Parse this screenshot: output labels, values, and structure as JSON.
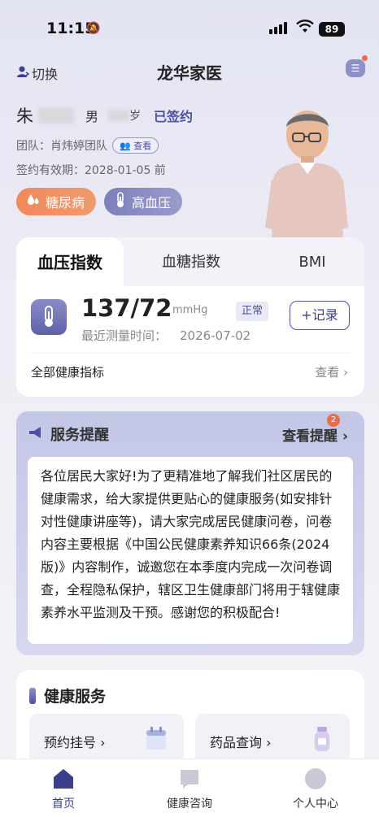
{
  "status": {
    "time": "11:15",
    "battery": "89"
  },
  "nav": {
    "switch_label": "切换",
    "title": "龙华家医"
  },
  "profile": {
    "surname": "朱",
    "gender": "男",
    "age_suffix": "岁",
    "sign_status": "已签约",
    "team_label": "团队：肖炜婷团队",
    "view_label": "查看",
    "validity": "签约有效期：2028-01-05 前",
    "tags": [
      {
        "label": "糖尿病",
        "color": "#f1895c"
      },
      {
        "label": "高血压",
        "color": "#7d7fba"
      }
    ]
  },
  "metrics": {
    "tabs": [
      "血压指数",
      "血糖指数",
      "BMI"
    ],
    "value": "137/72",
    "unit": "mmHg",
    "status": "正常",
    "record_button": "+记录",
    "measure_label": "最近测量时间：",
    "measure_date": "2026-07-02",
    "all_label": "全部健康指标",
    "view_label": "查看"
  },
  "service": {
    "title": "服务提醒",
    "view_label": "查看提醒",
    "badge": "2",
    "notice": "各位居民大家好!为了更精准地了解我们社区居民的健康需求，给大家提供更贴心的健康服务(如安排针对性健康讲座等)，请大家完成居民健康问卷，问卷内容主要根据《中国公民健康素养知识66条(2024版)》内容制作，诚邀您在本季度内完成一次问卷调查，全程隐私保护，辖区卫生健康部门将用于辖健康素养水平监测及干预。感谢您的积极配合!"
  },
  "health": {
    "title": "健康服务",
    "cards": [
      {
        "label": "预约挂号"
      },
      {
        "label": "药品查询"
      }
    ]
  },
  "tabbar": [
    {
      "label": "首页",
      "active": true
    },
    {
      "label": "健康咨询",
      "active": false
    },
    {
      "label": "个人中心",
      "active": false
    }
  ],
  "colors": {
    "accent": "#4b4fa5",
    "orange": "#f1895c",
    "badge": "#ea6b4a"
  }
}
